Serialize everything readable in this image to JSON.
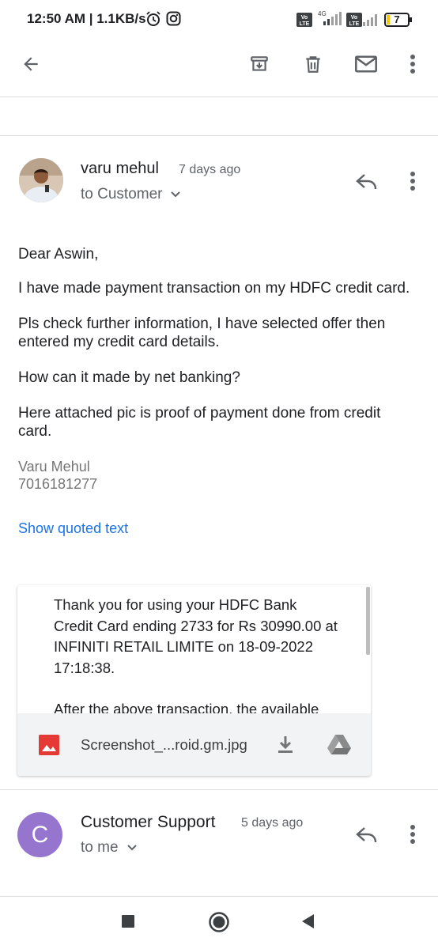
{
  "status_bar": {
    "time_speed": "12:50 AM | 1.1KB/s",
    "volte_label": "Vo LTE",
    "network_label": "4G",
    "battery_level": "7"
  },
  "toolbar": {
    "back_icon": "arrow-left-icon",
    "archive_icon": "archive-icon",
    "delete_icon": "trash-icon",
    "mail_icon": "envelope-icon",
    "more_icon": "more-vert-icon"
  },
  "message1": {
    "sender": "varu mehul",
    "time": "7 days ago",
    "to": "to Customer",
    "body": [
      "Dear Aswin,",
      "I have made payment transaction on my HDFC credit card.",
      "Pls check further information, I have selected offer then entered my credit card details.",
      "How can it made by net banking?",
      "Here attached pic is proof of payment done from credit card."
    ],
    "signature_name": "Varu Mehul",
    "signature_phone": "7016181277",
    "show_quoted": "Show quoted text",
    "attachment": {
      "preview_line1": "Thank you for using your HDFC Bank Credit Card ending 2733 for Rs 30990.00 at INFINITI RETAIL LIMITE on 18-09-2022 17:18:38.",
      "preview_line2": "After the above transaction, the available",
      "filename": "Screenshot_...roid.gm.jpg"
    }
  },
  "message2": {
    "avatar_letter": "C",
    "sender": "Customer Support",
    "time": "5 days ago",
    "to": "to me"
  },
  "colors": {
    "link": "#1a73e8",
    "avatar_c": "#9575cd",
    "image_icon": "#e53935"
  }
}
